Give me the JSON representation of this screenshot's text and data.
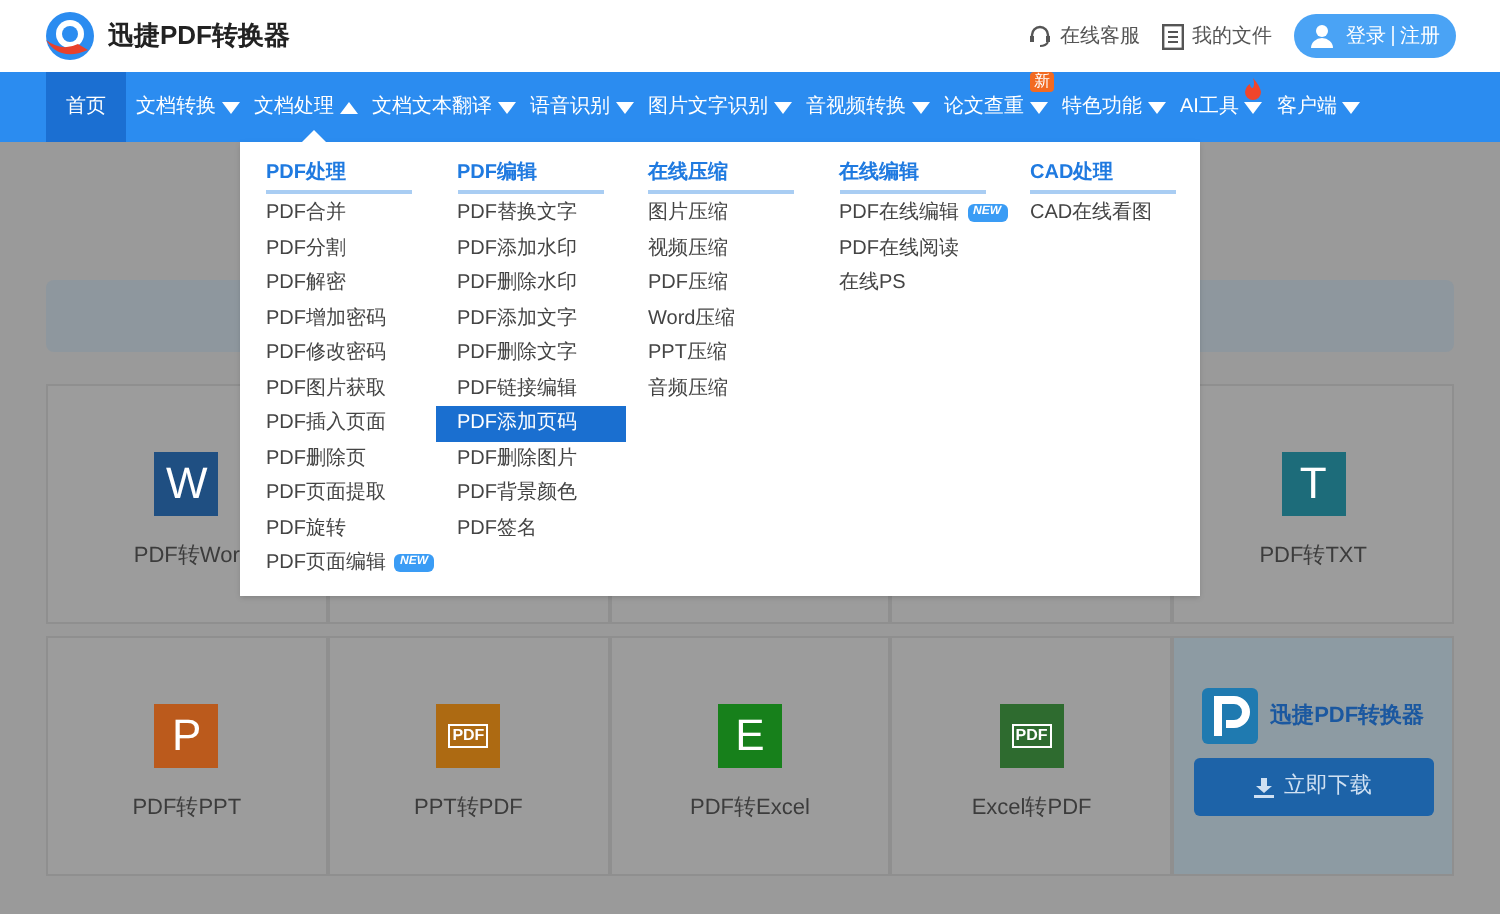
{
  "header": {
    "logo_text": "迅捷PDF转换器",
    "links": [
      {
        "label": "在线客服",
        "kind": "headset"
      },
      {
        "label": "我的文件",
        "kind": "file"
      }
    ],
    "login": "登录",
    "register": "注册"
  },
  "nav": [
    {
      "label": "首页",
      "selected": true,
      "caret": false,
      "expanded": false,
      "hot": false
    },
    {
      "label": "文档转换",
      "selected": false,
      "caret": true,
      "expanded": false,
      "hot": false
    },
    {
      "label": "文档处理",
      "selected": false,
      "caret": true,
      "expanded": true,
      "hot": false
    },
    {
      "label": "文档文本翻译",
      "selected": false,
      "caret": true,
      "expanded": false,
      "hot": false
    },
    {
      "label": "语音识别",
      "selected": false,
      "caret": true,
      "expanded": false,
      "hot": false
    },
    {
      "label": "图片文字识别",
      "selected": false,
      "caret": true,
      "expanded": false,
      "hot": false
    },
    {
      "label": "音视频转换",
      "selected": false,
      "caret": true,
      "expanded": false,
      "hot": false
    },
    {
      "label": "论文查重",
      "selected": false,
      "caret": true,
      "expanded": false,
      "hot": false,
      "badge": "新"
    },
    {
      "label": "特色功能",
      "selected": false,
      "caret": true,
      "expanded": false,
      "hot": false
    },
    {
      "label": "AI工具",
      "selected": false,
      "caret": true,
      "expanded": false,
      "hot": true
    },
    {
      "label": "客户端",
      "selected": false,
      "caret": true,
      "expanded": false,
      "hot": false
    }
  ],
  "menu": [
    {
      "title": "PDF处理",
      "items": [
        {
          "label": "PDF合并",
          "selected": false
        },
        {
          "label": "PDF分割",
          "selected": false
        },
        {
          "label": "PDF解密",
          "selected": false
        },
        {
          "label": "PDF增加密码",
          "selected": false
        },
        {
          "label": "PDF修改密码",
          "selected": false
        },
        {
          "label": "PDF图片获取",
          "selected": false
        },
        {
          "label": "PDF插入页面",
          "selected": false
        },
        {
          "label": "PDF删除页",
          "selected": false
        },
        {
          "label": "PDF页面提取",
          "selected": false
        },
        {
          "label": "PDF旋转",
          "selected": false
        },
        {
          "label": "PDF页面编辑",
          "selected": false,
          "badge": "NEW"
        }
      ]
    },
    {
      "title": "PDF编辑",
      "items": [
        {
          "label": "PDF替换文字",
          "selected": false
        },
        {
          "label": "PDF添加水印",
          "selected": false
        },
        {
          "label": "PDF删除水印",
          "selected": false
        },
        {
          "label": "PDF添加文字",
          "selected": false
        },
        {
          "label": "PDF删除文字",
          "selected": false
        },
        {
          "label": "PDF链接编辑",
          "selected": false
        },
        {
          "label": "PDF添加页码",
          "selected": true
        },
        {
          "label": "PDF删除图片",
          "selected": false
        },
        {
          "label": "PDF背景颜色",
          "selected": false
        },
        {
          "label": "PDF签名",
          "selected": false
        }
      ]
    },
    {
      "title": "在线压缩",
      "items": [
        {
          "label": "图片压缩",
          "selected": false
        },
        {
          "label": "视频压缩",
          "selected": false
        },
        {
          "label": "PDF压缩",
          "selected": false
        },
        {
          "label": "Word压缩",
          "selected": false
        },
        {
          "label": "PPT压缩",
          "selected": false
        },
        {
          "label": "音频压缩",
          "selected": false
        }
      ]
    },
    {
      "title": "在线编辑",
      "items": [
        {
          "label": "PDF在线编辑",
          "selected": false,
          "badge": "NEW"
        },
        {
          "label": "PDF在线阅读",
          "selected": false
        },
        {
          "label": "在线PS",
          "selected": false
        }
      ]
    },
    {
      "title": "CAD处理",
      "items": [
        {
          "label": "CAD在线看图",
          "selected": false
        }
      ]
    }
  ],
  "cards": [
    {
      "kind": "tool",
      "label": "PDF转Wor",
      "icon_text": "W",
      "color": "#1f4f82"
    },
    {
      "kind": "covered"
    },
    {
      "kind": "covered"
    },
    {
      "kind": "covered"
    },
    {
      "kind": "tool",
      "label": "PDF转TXT",
      "icon_text": "T",
      "color": "#1d6c7a"
    },
    {
      "kind": "tool",
      "label": "PDF转PPT",
      "icon_text": "P",
      "color": "#bb5a1c"
    },
    {
      "kind": "tool",
      "label": "PPT转PDF",
      "icon_text": "PDF",
      "color": "#ad6a12",
      "framed": true
    },
    {
      "kind": "tool",
      "label": "PDF转Excel",
      "icon_text": "E",
      "color": "#17801b"
    },
    {
      "kind": "tool",
      "label": "Excel转PDF",
      "icon_text": "PDF",
      "color": "#2e6b2f",
      "framed": true
    },
    {
      "kind": "download",
      "logo_text": "迅捷PDF转换器",
      "button": "立即下载"
    }
  ]
}
